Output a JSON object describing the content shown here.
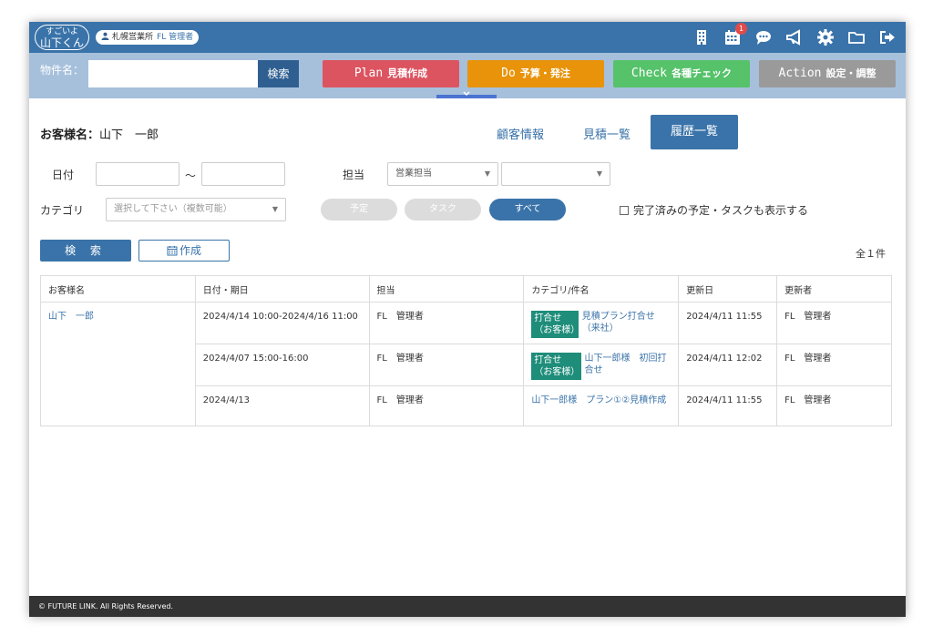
{
  "app": {
    "logo_line1": "すごいよ",
    "logo_line2": "山下くん",
    "office": "札幌営業所",
    "role": "FL 管理者",
    "calendar_badge": "1"
  },
  "toolbar": {
    "property_label": "物件名：",
    "property_value": "",
    "search_button": "検索",
    "phases": [
      {
        "key": "Plan",
        "label": "見積作成"
      },
      {
        "key": "Do",
        "label": "予算・発注"
      },
      {
        "key": "Check",
        "label": "各種チェック"
      },
      {
        "key": "Action",
        "label": "設定・調整"
      }
    ]
  },
  "header": {
    "customer_label": "お客様名：",
    "customer_name": "山下　一郎",
    "links": [
      "顧客情報",
      "見積一覧",
      "履歴一覧"
    ]
  },
  "filters": {
    "date_label": "日付",
    "tilde": "～",
    "staff_label": "担当",
    "staff_select": "営業担当",
    "category_label": "カテゴリ",
    "category_placeholder": "選択して下さい（複数可能）",
    "pills": [
      "予定",
      "タスク",
      "すべて"
    ],
    "show_done_label": "完了済みの予定・タスクも表示する"
  },
  "actions": {
    "search": "検 索",
    "create": "作成",
    "count": "全１件"
  },
  "table": {
    "headers": [
      "お客様名",
      "日付・期日",
      "担当",
      "カテゴリ/件名",
      "更新日",
      "更新者"
    ],
    "customer": "山下　一郎",
    "rows": [
      {
        "date": "2024/4/14 10:00-2024/4/16 11:00",
        "staff": "FL　管理者",
        "tag": "打合せ（お客様）",
        "subject": "見積プラン打合せ（来社）",
        "updated": "2024/4/11 11:55",
        "updater": "FL　管理者"
      },
      {
        "date": "2024/4/07 15:00-16:00",
        "staff": "FL　管理者",
        "tag": "打合せ（お客様）",
        "subject": "山下一郎様　初回打合せ",
        "updated": "2024/4/11 12:02",
        "updater": "FL　管理者"
      },
      {
        "date": "2024/4/13",
        "staff": "FL　管理者",
        "tag": "",
        "subject": "山下一郎様　プラン①②見積作成",
        "updated": "2024/4/11 11:55",
        "updater": "FL　管理者"
      }
    ]
  },
  "footer": {
    "copyright": "© FUTURE LINK. All Rights Reserved."
  },
  "colors": {
    "topbar": "#3a73a9",
    "plan": "#dc5460",
    "do": "#e8930a",
    "check": "#56c26a",
    "action": "#9a9a9a",
    "tag": "#1e8d7a"
  }
}
